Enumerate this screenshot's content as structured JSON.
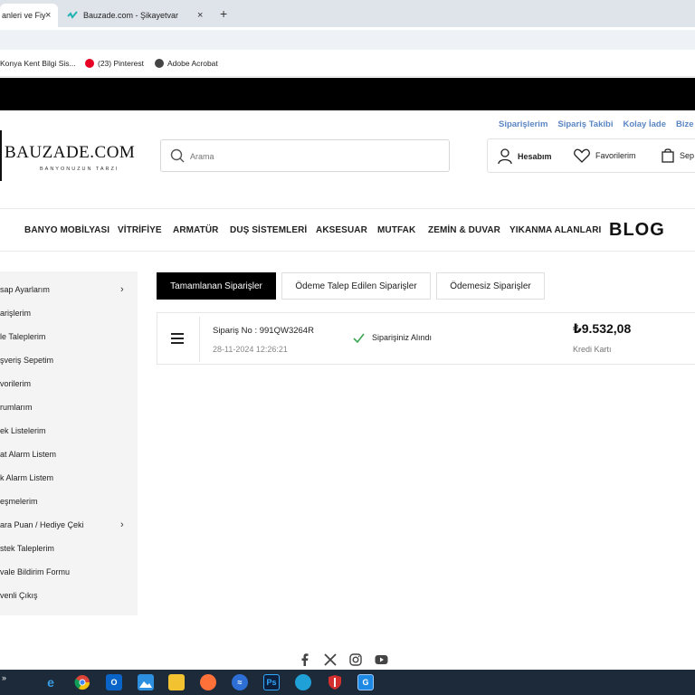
{
  "browser": {
    "tabs": [
      {
        "label": "anleri ve Fiy",
        "active": true
      },
      {
        "label": "Bauzade.com - Şikayetvar",
        "active": false
      }
    ],
    "new_tab_symbol": "+",
    "close_symbol": "×",
    "bookmarks": [
      {
        "label": "Konya Kent Bilgi Sis...",
        "icon": "globe-icon"
      },
      {
        "label": "(23) Pinterest",
        "icon": "pinterest-icon",
        "color": "#e60023"
      },
      {
        "label": "Adobe Acrobat",
        "icon": "globe-icon"
      }
    ]
  },
  "header": {
    "top_links": [
      "Siparişlerim",
      "Sipariş Takibi",
      "Kolay İade",
      "Bize U"
    ],
    "logo_title": "BAUZADE.COM",
    "logo_subtitle": "BANYONUZUN TARZI",
    "search_placeholder": "Arama",
    "account_label": "Hesabım",
    "favorites_label": "Favorilerim",
    "cart_label": "Sep"
  },
  "nav": {
    "items": [
      "BANYO MOBİLYASI",
      "VİTRİFİYE",
      "ARMATÜR",
      "DUŞ SİSTEMLERİ",
      "AKSESUAR",
      "MUTFAK",
      "ZEMİN & DUVAR",
      "YIKANMA ALANLARI"
    ],
    "blog": "BLOG"
  },
  "sidebar": {
    "items": [
      {
        "label": "sap Ayarlarım",
        "has_arrow": true
      },
      {
        "label": "arişlerim",
        "has_arrow": false
      },
      {
        "label": "le Taleplerim",
        "has_arrow": false
      },
      {
        "label": "şveriş Sepetim",
        "has_arrow": false
      },
      {
        "label": "vorilerim",
        "has_arrow": false
      },
      {
        "label": "rumlarım",
        "has_arrow": false
      },
      {
        "label": "ek Listelerim",
        "has_arrow": false
      },
      {
        "label": "at Alarm Listem",
        "has_arrow": false
      },
      {
        "label": "k Alarm Listem",
        "has_arrow": false
      },
      {
        "label": "eşmelerim",
        "has_arrow": false
      },
      {
        "label": "ara Puan / Hediye Çeki",
        "has_arrow": true
      },
      {
        "label": "stek Taleplerim",
        "has_arrow": false
      },
      {
        "label": "vale Bildirim Formu",
        "has_arrow": false
      },
      {
        "label": "venli Çıkış",
        "has_arrow": false
      }
    ],
    "arrow_symbol": "›"
  },
  "order_tabs": [
    {
      "label": "Tamamlanan Siparişler",
      "active": true
    },
    {
      "label": "Ödeme Talep Edilen Siparişler",
      "active": false
    },
    {
      "label": "Ödemesiz Siparişler",
      "active": false
    }
  ],
  "order": {
    "number_label": "Sipariş No : 991QW3264R",
    "date": "28-11-2024 12:26:21",
    "status": "Siparişiniz Alındı",
    "status_color": "#3aa655",
    "amount": "₺9.532,08",
    "payment_method": "Kredi Kartı"
  },
  "footer": {
    "social_icons": [
      "facebook-icon",
      "x-icon",
      "instagram-icon",
      "youtube-icon"
    ]
  },
  "taskbar": {
    "icons": [
      "ie-icon",
      "chrome-icon",
      "outlook-icon",
      "photos-icon",
      "explorer-icon",
      "firefox-icon",
      "app-icon",
      "photoshop-icon",
      "edge-icon",
      "shield-icon",
      "app2-icon"
    ],
    "photoshop_label": "Ps"
  }
}
